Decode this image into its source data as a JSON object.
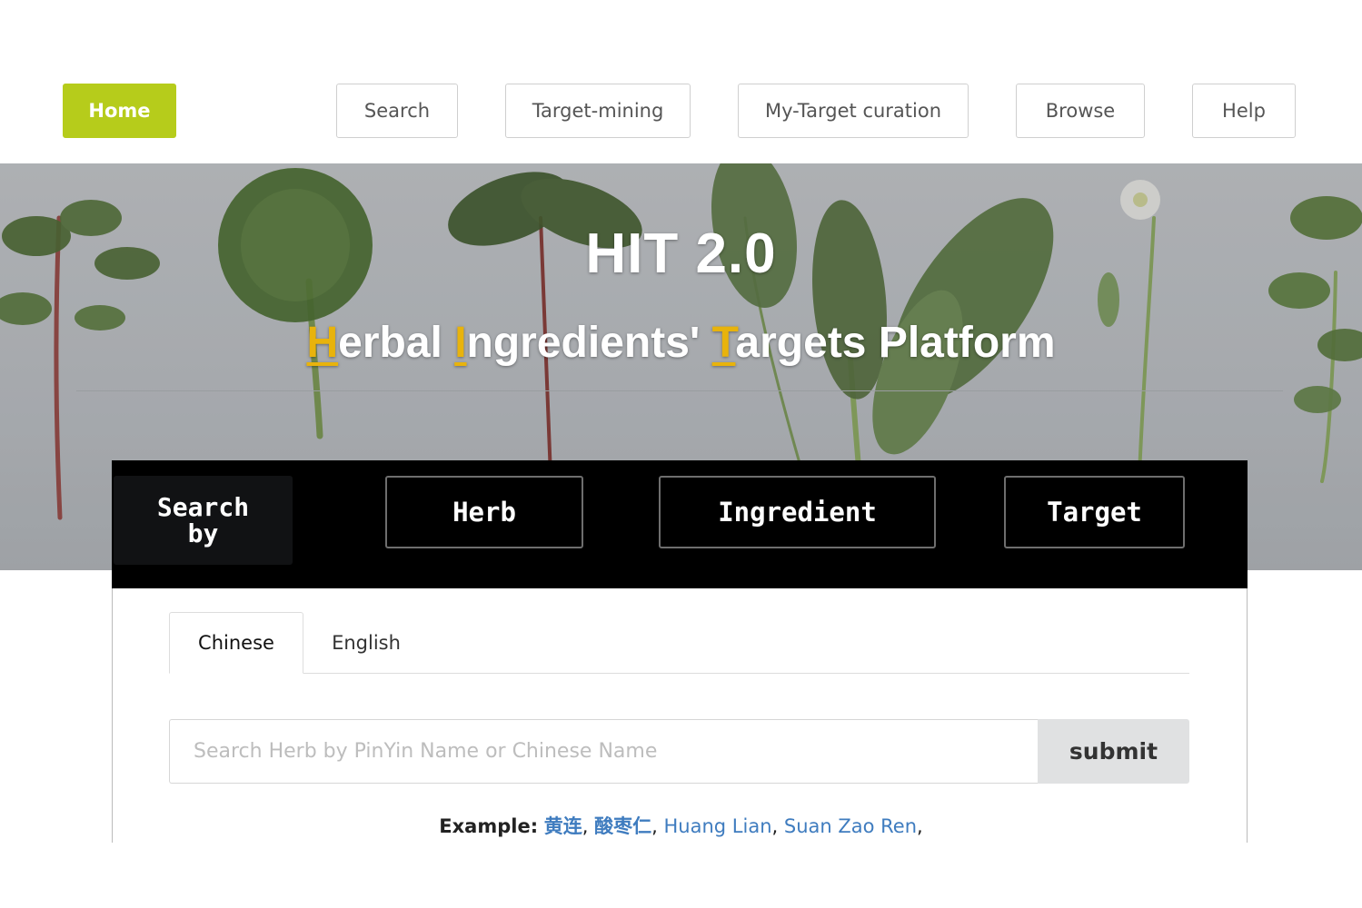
{
  "nav": {
    "home": "Home",
    "search": "Search",
    "target_mining": "Target-mining",
    "my_target_curation": "My-Target curation",
    "browse": "Browse",
    "help": "Help"
  },
  "hero": {
    "title": "HIT  2.0",
    "subtitle_parts": [
      {
        "hl": "H",
        "rest": "erbal "
      },
      {
        "hl": "I",
        "rest": "ngredients' "
      },
      {
        "hl": "T",
        "rest": "argets Platform"
      }
    ]
  },
  "search_by": {
    "label_line1": "Search",
    "label_line2": "by",
    "options": [
      "Herb",
      "Ingredient",
      "Target"
    ]
  },
  "tabs": {
    "chinese": "Chinese",
    "english": "English",
    "active": "Chinese"
  },
  "search": {
    "placeholder": "Search Herb by PinYin Name or Chinese Name",
    "value": "",
    "submit_label": "submit"
  },
  "examples": {
    "label": "Example:",
    "items": [
      "黄连",
      "酸枣仁",
      "Huang Lian",
      "Suan Zao Ren"
    ]
  },
  "colors": {
    "home_button": "#b6cc1b",
    "highlight_letter": "#e8b30c",
    "example_link": "#3f7cbf",
    "search_bar_bg": "#000000"
  }
}
